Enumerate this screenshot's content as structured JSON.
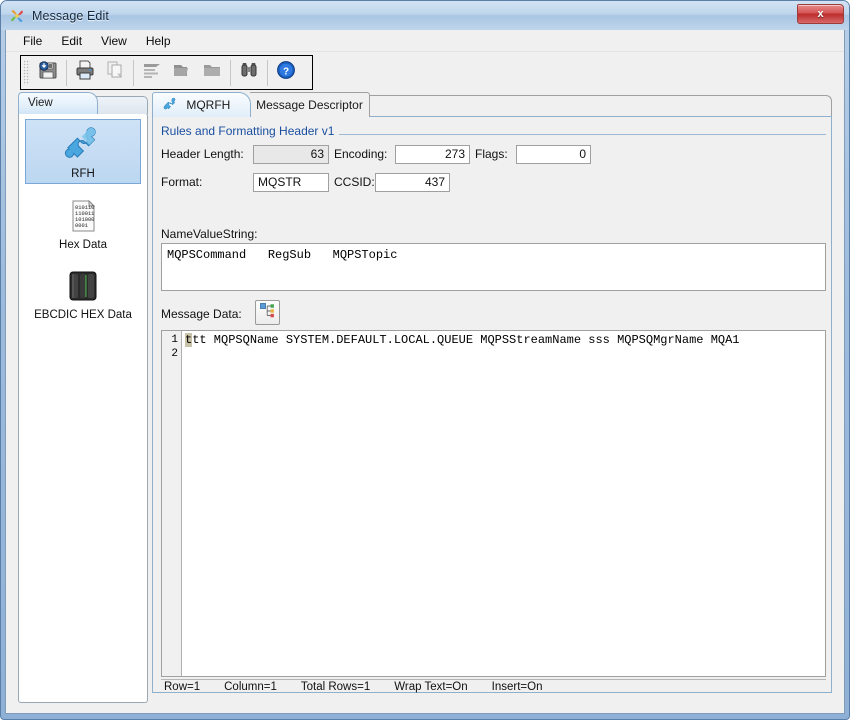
{
  "window": {
    "title": "Message Edit",
    "icon": "pinwheel-icon",
    "close_label": "x",
    "accent_blue": "#1a4fa0",
    "titlebar_gradient_top": "#d3e3f4",
    "close_red": "#bb2b2b"
  },
  "menubar": {
    "items": [
      {
        "label": "File"
      },
      {
        "label": "Edit"
      },
      {
        "label": "View"
      },
      {
        "label": "Help"
      }
    ]
  },
  "toolbar": {
    "buttons": [
      {
        "icon": "save-icon",
        "title": "Save"
      },
      {
        "icon": "print-icon",
        "title": "Print"
      },
      {
        "icon": "copy-icon",
        "title": "Copy"
      },
      {
        "icon": "align-left-icon",
        "title": "Format"
      },
      {
        "icon": "folder-open-icon",
        "title": "Open Folder"
      },
      {
        "icon": "folder-icon",
        "title": "Folder"
      },
      {
        "icon": "binoculars-icon",
        "title": "Find"
      },
      {
        "icon": "help-icon",
        "title": "Help"
      }
    ]
  },
  "left_panel": {
    "tab_label": "View",
    "items": [
      {
        "label": "RFH",
        "icon": "puzzle-piece-icon",
        "selected": true
      },
      {
        "label": "Hex Data",
        "icon": "binary-page-icon",
        "selected": false
      },
      {
        "label": "EBCDIC HEX Data",
        "icon": "tape-drive-icon",
        "selected": false
      }
    ]
  },
  "right_pane": {
    "tabs": [
      {
        "label": "MQRFH",
        "icon": "puzzle-piece-icon",
        "active": true
      },
      {
        "label": "Message Descriptor",
        "icon": "",
        "active": false
      }
    ],
    "group_title": "Rules and Formatting Header v1",
    "fields": [
      {
        "label": "Header Length:",
        "value": "63",
        "readonly": true
      },
      {
        "label": "Encoding:",
        "value": "273",
        "readonly": false
      },
      {
        "label": "Flags:",
        "value": "0",
        "readonly": false
      },
      {
        "label": "Format:",
        "value": "MQSTR",
        "readonly": false
      },
      {
        "label": "CCSID:",
        "value": "437",
        "readonly": false
      }
    ],
    "namevaluestring": {
      "label": "NameValueString:",
      "value": "MQPSCommand   RegSub   MQPSTopic"
    },
    "message_data": {
      "label": "Message Data:",
      "button_icon": "structure-tree-icon",
      "line_numbers": [
        "1",
        "2"
      ],
      "caret_char": "t",
      "line1_rest": "tt MQPSQName SYSTEM.DEFAULT.LOCAL.QUEUE MQPSStreamName sss MQPSQMgrName MQA1",
      "line2": ""
    },
    "statusbar": [
      {
        "label": "Row=1"
      },
      {
        "label": "Column=1"
      },
      {
        "label": "Total Rows=1"
      },
      {
        "label": "Wrap Text=On"
      },
      {
        "label": "Insert=On"
      }
    ]
  }
}
